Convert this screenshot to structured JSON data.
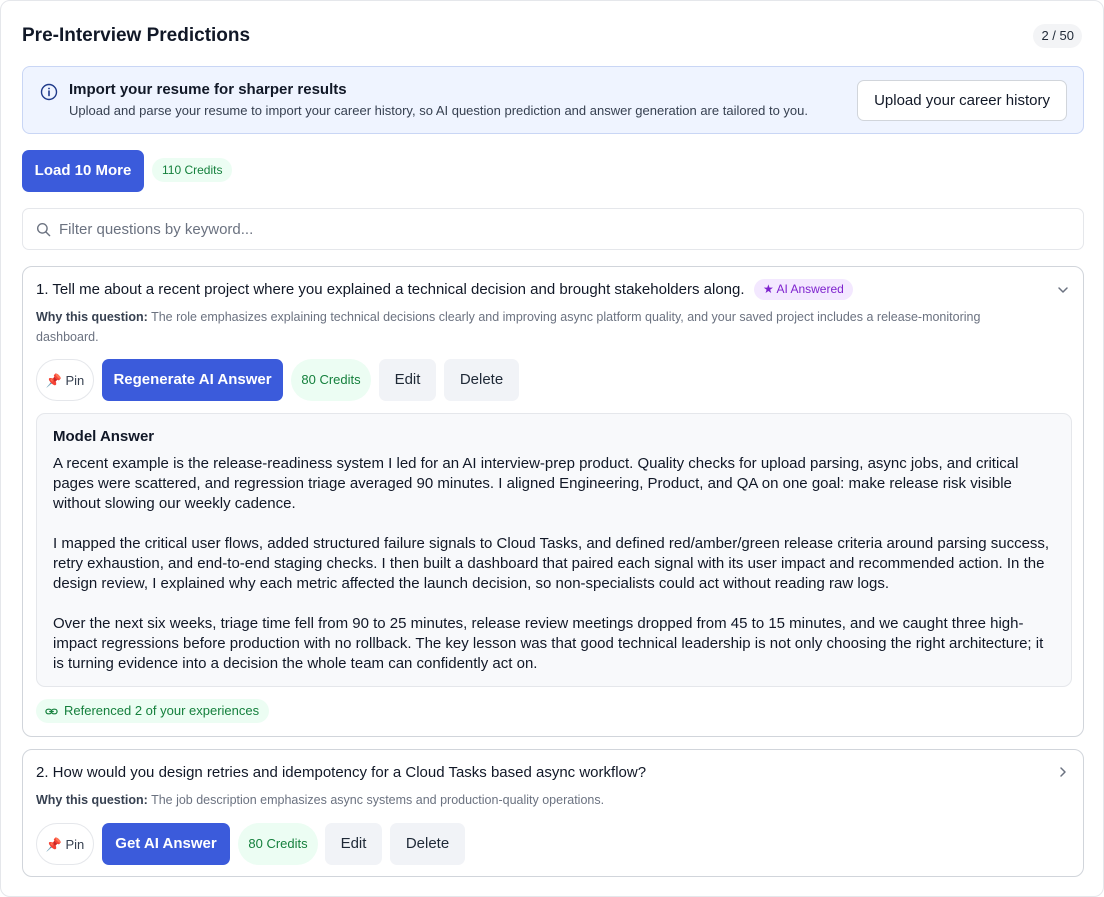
{
  "header": {
    "title": "Pre-Interview Predictions",
    "counter": "2 / 50"
  },
  "banner": {
    "title": "Import your resume for sharper results",
    "text": "Upload and parse your resume to import your career history, so AI question prediction and answer generation are tailored to you.",
    "button_label": "Upload your career history"
  },
  "toolbar": {
    "load_more_label": "Load 10 More",
    "credits": "110 Credits"
  },
  "search": {
    "placeholder": "Filter questions by keyword..."
  },
  "questions": [
    {
      "title": "1. Tell me about a recent project where you explained a technical decision and brought stakeholders along.",
      "badge": "AI Answered",
      "why_label": "Why this question:",
      "why_text": "The role emphasizes explaining technical decisions clearly and improving async platform quality, and your saved project includes a release-monitoring dashboard.",
      "pin_label": "Pin",
      "primary_label": "Regenerate AI Answer",
      "credits": "80 Credits",
      "edit_label": "Edit",
      "delete_label": "Delete",
      "answer_title": "Model Answer",
      "answer_paragraphs": [
        "A recent example is the release-readiness system I led for an AI interview-prep product. Quality checks for upload parsing, async jobs, and critical pages were scattered, and regression triage averaged 90 minutes. I aligned Engineering, Product, and QA on one goal: make release risk visible without slowing our weekly cadence.",
        "I mapped the critical user flows, added structured failure signals to Cloud Tasks, and defined red/amber/green release criteria around parsing success, retry exhaustion, and end-to-end staging checks. I then built a dashboard that paired each signal with its user impact and recommended action. In the design review, I explained why each metric affected the launch decision, so non-specialists could act without reading raw logs.",
        "Over the next six weeks, triage time fell from 90 to 25 minutes, release review meetings dropped from 45 to 15 minutes, and we caught three high-impact regressions before production with no rollback. The key lesson was that good technical leadership is not only choosing the right architecture; it is turning evidence into a decision the whole team can confidently act on."
      ],
      "referenced": "Referenced 2 of your experiences"
    },
    {
      "title": "2. How would you design retries and idempotency for a Cloud Tasks based async workflow?",
      "why_label": "Why this question:",
      "why_text": "The job description emphasizes async systems and production-quality operations.",
      "pin_label": "Pin",
      "primary_label": "Get AI Answer",
      "credits": "80 Credits",
      "edit_label": "Edit",
      "delete_label": "Delete"
    }
  ],
  "colors": {
    "primary": "#3b5bdb",
    "credits_bg": "#ecfdf3",
    "credits_text": "#15803d",
    "ai_badge_bg": "#f3e8ff",
    "ai_badge_text": "#7e22ce"
  },
  "icons": [
    "info-icon",
    "search-icon",
    "pin-icon",
    "star-icon",
    "chevron-down-icon",
    "chevron-right-icon",
    "link-icon"
  ]
}
